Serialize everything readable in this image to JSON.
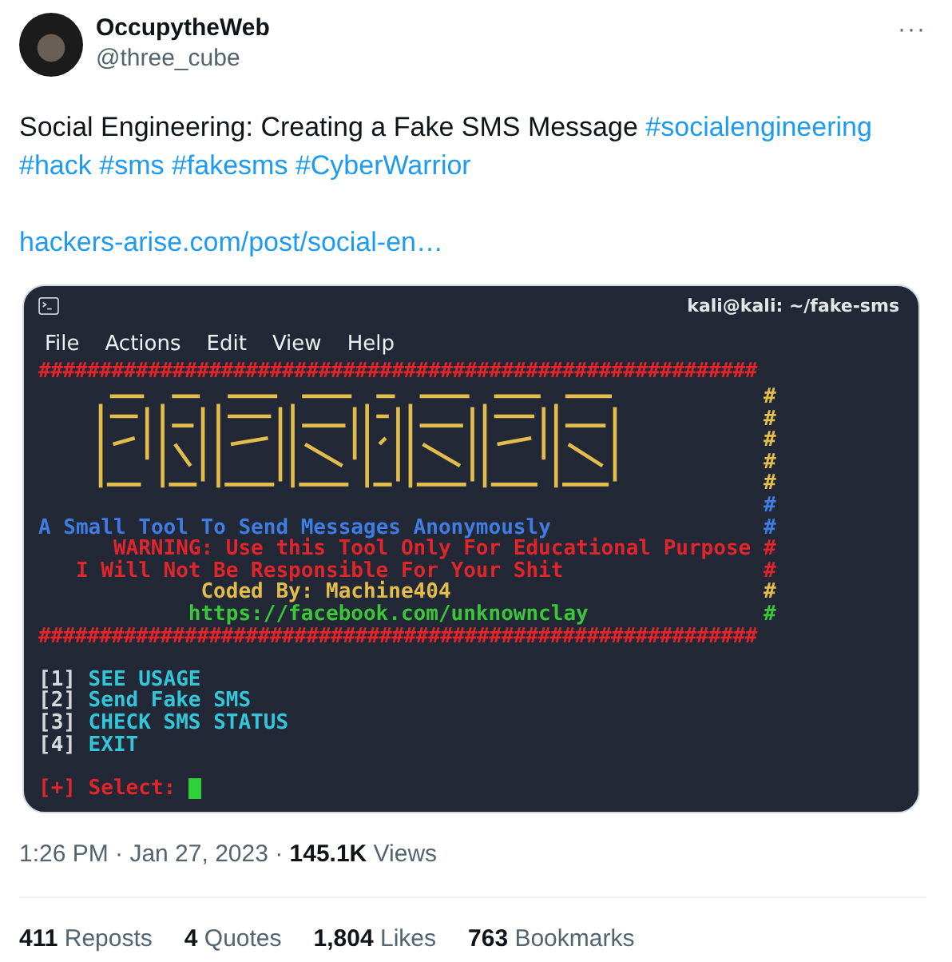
{
  "author": {
    "name": "OccupytheWeb",
    "handle": "@three_cube"
  },
  "more": "···",
  "body": {
    "text": "Social Engineering: Creating a Fake SMS Message",
    "hashtags": [
      "#socialengineering",
      "#hack",
      "#sms",
      "#fakesms",
      "#CyberWarrior"
    ],
    "link": "hackers-arise.com/post/social-en…"
  },
  "terminal": {
    "title": "kali@kali: ~/fake-sms",
    "menu": [
      "File",
      "Actions",
      "Edit",
      "View",
      "Help"
    ],
    "lines": [
      {
        "kind": "rule",
        "text": "###########################################################",
        "color": "#e0262b"
      },
      {
        "kind": "art",
        "color": "#e2bd4c",
        "marks": [
          {
            "text": "#",
            "color": "#e2bd4c"
          },
          {
            "text": "#",
            "color": "#e2bd4c"
          },
          {
            "text": "#",
            "color": "#e2bd4c"
          },
          {
            "text": "#",
            "color": "#e2bd4c"
          },
          {
            "text": "#",
            "color": "#e2bd4c"
          }
        ]
      },
      {
        "kind": "text",
        "mark": {
          "text": "#",
          "color": "#3f7de3"
        }
      },
      {
        "kind": "text",
        "text": "A Small Tool To Send Messages Anonymously",
        "color": "#3f7de3",
        "mark": {
          "text": "#",
          "color": "#3f7de3"
        }
      },
      {
        "kind": "text",
        "text": "WARNING: Use this Tool Only For Educational Purpose",
        "color": "#e0262b",
        "mark": {
          "text": "#",
          "color": "#e0262b"
        }
      },
      {
        "kind": "text",
        "text": "I Will Not Be Responsible For Your Shit",
        "color": "#e0262b",
        "mark": {
          "text": "#",
          "color": "#e0262b"
        }
      },
      {
        "kind": "text",
        "text": "Coded By: Machine404",
        "color": "#e2bd4c",
        "mark": {
          "text": "#",
          "color": "#e2bd4c"
        }
      },
      {
        "kind": "text",
        "text": "https://facebook.com/unknownclay",
        "color": "#3cc63a",
        "mark": {
          "text": "#",
          "color": "#3cc63a"
        }
      },
      {
        "kind": "rule",
        "text": "###########################################################",
        "color": "#e0262b"
      },
      {
        "kind": "blank"
      },
      {
        "kind": "option",
        "key": "[1]",
        "text": "SEE USAGE"
      },
      {
        "kind": "option",
        "key": "[2]",
        "text": "Send Fake SMS"
      },
      {
        "kind": "option",
        "key": "[3]",
        "text": "CHECK SMS STATUS"
      },
      {
        "kind": "option",
        "key": "[4]",
        "text": "EXIT"
      },
      {
        "kind": "blank"
      },
      {
        "kind": "prompt",
        "text": "[+] Select:"
      }
    ]
  },
  "meta": {
    "time": "1:26 PM",
    "separator": "·",
    "date": "Jan 27, 2023",
    "views": {
      "count": "145.1K",
      "label": "Views"
    }
  },
  "stats": [
    {
      "count": "411",
      "label": "Reposts"
    },
    {
      "count": "4",
      "label": "Quotes"
    },
    {
      "count": "1,804",
      "label": "Likes"
    },
    {
      "count": "763",
      "label": "Bookmarks"
    }
  ]
}
